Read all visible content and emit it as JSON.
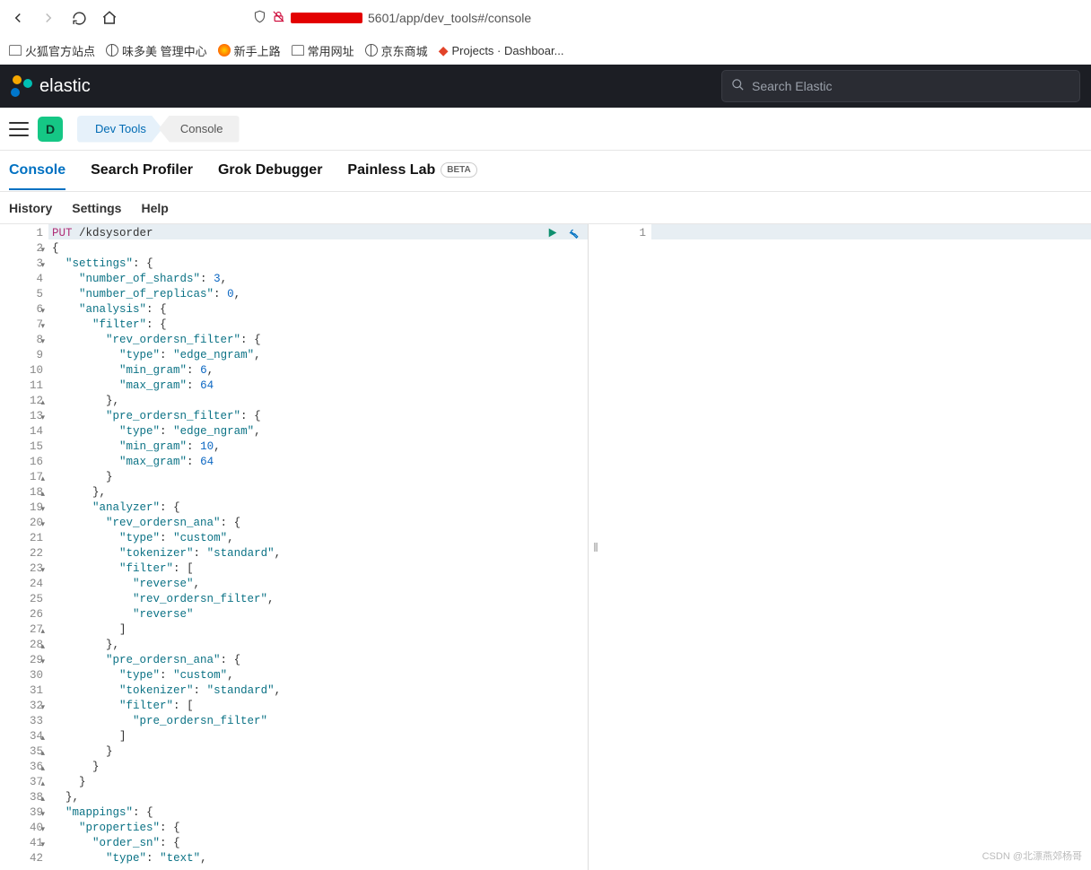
{
  "browser": {
    "url_tail": "5601/app/dev_tools#/console",
    "bookmarks": [
      "火狐官方站点",
      "味多美 管理中心",
      "新手上路",
      "常用网址",
      "京东商城",
      "Projects · Dashboar..."
    ]
  },
  "header": {
    "brand": "elastic",
    "search_placeholder": "Search Elastic",
    "space_letter": "D",
    "crumb1": "Dev Tools",
    "crumb2": "Console"
  },
  "tabs": {
    "console": "Console",
    "profiler": "Search Profiler",
    "grok": "Grok Debugger",
    "painless": "Painless Lab",
    "beta": "BETA"
  },
  "toolbar": {
    "history": "History",
    "settings": "Settings",
    "help": "Help"
  },
  "editor": {
    "method": "PUT",
    "path": "/kdsysorder",
    "lines": [
      {
        "n": 1
      },
      {
        "n": 2,
        "f": "▾"
      },
      {
        "n": 3,
        "f": "▾"
      },
      {
        "n": 4
      },
      {
        "n": 5
      },
      {
        "n": 6,
        "f": "▾"
      },
      {
        "n": 7,
        "f": "▾"
      },
      {
        "n": 8,
        "f": "▾"
      },
      {
        "n": 9
      },
      {
        "n": 10
      },
      {
        "n": 11
      },
      {
        "n": 12,
        "f": "▴"
      },
      {
        "n": 13,
        "f": "▾"
      },
      {
        "n": 14
      },
      {
        "n": 15
      },
      {
        "n": 16
      },
      {
        "n": 17,
        "f": "▴"
      },
      {
        "n": 18,
        "f": "▴"
      },
      {
        "n": 19,
        "f": "▾"
      },
      {
        "n": 20,
        "f": "▾"
      },
      {
        "n": 21
      },
      {
        "n": 22
      },
      {
        "n": 23,
        "f": "▾"
      },
      {
        "n": 24
      },
      {
        "n": 25
      },
      {
        "n": 26
      },
      {
        "n": 27,
        "f": "▴"
      },
      {
        "n": 28,
        "f": "▴"
      },
      {
        "n": 29,
        "f": "▾"
      },
      {
        "n": 30
      },
      {
        "n": 31
      },
      {
        "n": 32,
        "f": "▾"
      },
      {
        "n": 33
      },
      {
        "n": 34,
        "f": "▴"
      },
      {
        "n": 35,
        "f": "▴"
      },
      {
        "n": 36,
        "f": "▴"
      },
      {
        "n": 37,
        "f": "▴"
      },
      {
        "n": 38,
        "f": "▴"
      },
      {
        "n": 39,
        "f": "▾"
      },
      {
        "n": 40,
        "f": "▾"
      },
      {
        "n": 41,
        "f": "▾"
      },
      {
        "n": 42
      }
    ],
    "body_rows": [
      [
        [
          "method",
          "PUT"
        ],
        [
          "plain",
          " "
        ],
        [
          "plain",
          "/kdsysorder"
        ]
      ],
      [
        [
          "pun",
          "{"
        ]
      ],
      [
        [
          "plain",
          "  "
        ],
        [
          "str",
          "\"settings\""
        ],
        [
          "pun",
          ":"
        ],
        [
          "plain",
          " "
        ],
        [
          "pun",
          "{"
        ]
      ],
      [
        [
          "plain",
          "    "
        ],
        [
          "str",
          "\"number_of_shards\""
        ],
        [
          "pun",
          ":"
        ],
        [
          "plain",
          " "
        ],
        [
          "num",
          "3"
        ],
        [
          "pun",
          ","
        ]
      ],
      [
        [
          "plain",
          "    "
        ],
        [
          "str",
          "\"number_of_replicas\""
        ],
        [
          "pun",
          ":"
        ],
        [
          "plain",
          " "
        ],
        [
          "num",
          "0"
        ],
        [
          "pun",
          ","
        ]
      ],
      [
        [
          "plain",
          "    "
        ],
        [
          "str",
          "\"analysis\""
        ],
        [
          "pun",
          ":"
        ],
        [
          "plain",
          " "
        ],
        [
          "pun",
          "{"
        ]
      ],
      [
        [
          "plain",
          "      "
        ],
        [
          "str",
          "\"filter\""
        ],
        [
          "pun",
          ":"
        ],
        [
          "plain",
          " "
        ],
        [
          "pun",
          "{"
        ]
      ],
      [
        [
          "plain",
          "        "
        ],
        [
          "str",
          "\"rev_ordersn_filter\""
        ],
        [
          "pun",
          ":"
        ],
        [
          "plain",
          " "
        ],
        [
          "pun",
          "{"
        ]
      ],
      [
        [
          "plain",
          "          "
        ],
        [
          "str",
          "\"type\""
        ],
        [
          "pun",
          ":"
        ],
        [
          "plain",
          " "
        ],
        [
          "str",
          "\"edge_ngram\""
        ],
        [
          "pun",
          ","
        ]
      ],
      [
        [
          "plain",
          "          "
        ],
        [
          "str",
          "\"min_gram\""
        ],
        [
          "pun",
          ":"
        ],
        [
          "plain",
          " "
        ],
        [
          "num",
          "6"
        ],
        [
          "pun",
          ","
        ]
      ],
      [
        [
          "plain",
          "          "
        ],
        [
          "str",
          "\"max_gram\""
        ],
        [
          "pun",
          ":"
        ],
        [
          "plain",
          " "
        ],
        [
          "num",
          "64"
        ]
      ],
      [
        [
          "plain",
          "        "
        ],
        [
          "pun",
          "},"
        ]
      ],
      [
        [
          "plain",
          "        "
        ],
        [
          "str",
          "\"pre_ordersn_filter\""
        ],
        [
          "pun",
          ":"
        ],
        [
          "plain",
          " "
        ],
        [
          "pun",
          "{"
        ]
      ],
      [
        [
          "plain",
          "          "
        ],
        [
          "str",
          "\"type\""
        ],
        [
          "pun",
          ":"
        ],
        [
          "plain",
          " "
        ],
        [
          "str",
          "\"edge_ngram\""
        ],
        [
          "pun",
          ","
        ]
      ],
      [
        [
          "plain",
          "          "
        ],
        [
          "str",
          "\"min_gram\""
        ],
        [
          "pun",
          ":"
        ],
        [
          "plain",
          " "
        ],
        [
          "num",
          "10"
        ],
        [
          "pun",
          ","
        ]
      ],
      [
        [
          "plain",
          "          "
        ],
        [
          "str",
          "\"max_gram\""
        ],
        [
          "pun",
          ":"
        ],
        [
          "plain",
          " "
        ],
        [
          "num",
          "64"
        ]
      ],
      [
        [
          "plain",
          "        "
        ],
        [
          "pun",
          "}"
        ]
      ],
      [
        [
          "plain",
          "      "
        ],
        [
          "pun",
          "},"
        ]
      ],
      [
        [
          "plain",
          "      "
        ],
        [
          "str",
          "\"analyzer\""
        ],
        [
          "pun",
          ":"
        ],
        [
          "plain",
          " "
        ],
        [
          "pun",
          "{"
        ]
      ],
      [
        [
          "plain",
          "        "
        ],
        [
          "str",
          "\"rev_ordersn_ana\""
        ],
        [
          "pun",
          ":"
        ],
        [
          "plain",
          " "
        ],
        [
          "pun",
          "{"
        ]
      ],
      [
        [
          "plain",
          "          "
        ],
        [
          "str",
          "\"type\""
        ],
        [
          "pun",
          ":"
        ],
        [
          "plain",
          " "
        ],
        [
          "str",
          "\"custom\""
        ],
        [
          "pun",
          ","
        ]
      ],
      [
        [
          "plain",
          "          "
        ],
        [
          "str",
          "\"tokenizer\""
        ],
        [
          "pun",
          ":"
        ],
        [
          "plain",
          " "
        ],
        [
          "str",
          "\"standard\""
        ],
        [
          "pun",
          ","
        ]
      ],
      [
        [
          "plain",
          "          "
        ],
        [
          "str",
          "\"filter\""
        ],
        [
          "pun",
          ":"
        ],
        [
          "plain",
          " "
        ],
        [
          "pun",
          "["
        ]
      ],
      [
        [
          "plain",
          "            "
        ],
        [
          "str",
          "\"reverse\""
        ],
        [
          "pun",
          ","
        ]
      ],
      [
        [
          "plain",
          "            "
        ],
        [
          "str",
          "\"rev_ordersn_filter\""
        ],
        [
          "pun",
          ","
        ]
      ],
      [
        [
          "plain",
          "            "
        ],
        [
          "str",
          "\"reverse\""
        ]
      ],
      [
        [
          "plain",
          "          "
        ],
        [
          "pun",
          "]"
        ]
      ],
      [
        [
          "plain",
          "        "
        ],
        [
          "pun",
          "},"
        ]
      ],
      [
        [
          "plain",
          "        "
        ],
        [
          "str",
          "\"pre_ordersn_ana\""
        ],
        [
          "pun",
          ":"
        ],
        [
          "plain",
          " "
        ],
        [
          "pun",
          "{"
        ]
      ],
      [
        [
          "plain",
          "          "
        ],
        [
          "str",
          "\"type\""
        ],
        [
          "pun",
          ":"
        ],
        [
          "plain",
          " "
        ],
        [
          "str",
          "\"custom\""
        ],
        [
          "pun",
          ","
        ]
      ],
      [
        [
          "plain",
          "          "
        ],
        [
          "str",
          "\"tokenizer\""
        ],
        [
          "pun",
          ":"
        ],
        [
          "plain",
          " "
        ],
        [
          "str",
          "\"standard\""
        ],
        [
          "pun",
          ","
        ]
      ],
      [
        [
          "plain",
          "          "
        ],
        [
          "str",
          "\"filter\""
        ],
        [
          "pun",
          ":"
        ],
        [
          "plain",
          " "
        ],
        [
          "pun",
          "["
        ]
      ],
      [
        [
          "plain",
          "            "
        ],
        [
          "str",
          "\"pre_ordersn_filter\""
        ]
      ],
      [
        [
          "plain",
          "          "
        ],
        [
          "pun",
          "]"
        ]
      ],
      [
        [
          "plain",
          "        "
        ],
        [
          "pun",
          "}"
        ]
      ],
      [
        [
          "plain",
          "      "
        ],
        [
          "pun",
          "}"
        ]
      ],
      [
        [
          "plain",
          "    "
        ],
        [
          "pun",
          "}"
        ]
      ],
      [
        [
          "plain",
          "  "
        ],
        [
          "pun",
          "},"
        ]
      ],
      [
        [
          "plain",
          "  "
        ],
        [
          "str",
          "\"mappings\""
        ],
        [
          "pun",
          ":"
        ],
        [
          "plain",
          " "
        ],
        [
          "pun",
          "{"
        ]
      ],
      [
        [
          "plain",
          "    "
        ],
        [
          "str",
          "\"properties\""
        ],
        [
          "pun",
          ":"
        ],
        [
          "plain",
          " "
        ],
        [
          "pun",
          "{"
        ]
      ],
      [
        [
          "plain",
          "      "
        ],
        [
          "str",
          "\"order_sn\""
        ],
        [
          "pun",
          ":"
        ],
        [
          "plain",
          " "
        ],
        [
          "pun",
          "{"
        ]
      ],
      [
        [
          "plain",
          "        "
        ],
        [
          "str",
          "\"type\""
        ],
        [
          "pun",
          ":"
        ],
        [
          "plain",
          " "
        ],
        [
          "str",
          "\"text\""
        ],
        [
          "pun",
          ","
        ]
      ]
    ]
  },
  "output": {
    "line1": "1"
  },
  "watermark": "CSDN @北漂燕郊杨哥"
}
